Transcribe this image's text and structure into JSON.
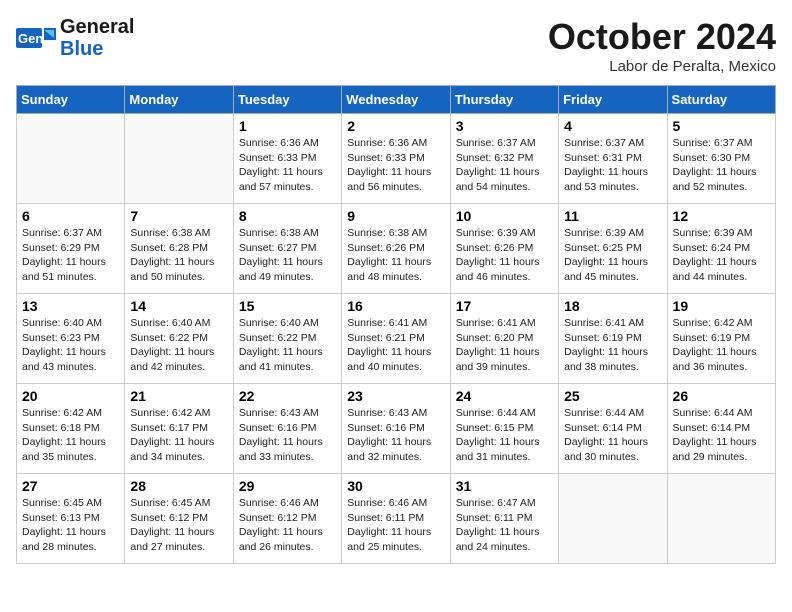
{
  "header": {
    "logo_line1": "General",
    "logo_line2": "Blue",
    "month": "October 2024",
    "location": "Labor de Peralta, Mexico"
  },
  "days_of_week": [
    "Sunday",
    "Monday",
    "Tuesday",
    "Wednesday",
    "Thursday",
    "Friday",
    "Saturday"
  ],
  "weeks": [
    [
      {
        "day": "",
        "sunrise": "",
        "sunset": "",
        "daylight": ""
      },
      {
        "day": "",
        "sunrise": "",
        "sunset": "",
        "daylight": ""
      },
      {
        "day": "1",
        "sunrise": "Sunrise: 6:36 AM",
        "sunset": "Sunset: 6:33 PM",
        "daylight": "Daylight: 11 hours and 57 minutes."
      },
      {
        "day": "2",
        "sunrise": "Sunrise: 6:36 AM",
        "sunset": "Sunset: 6:33 PM",
        "daylight": "Daylight: 11 hours and 56 minutes."
      },
      {
        "day": "3",
        "sunrise": "Sunrise: 6:37 AM",
        "sunset": "Sunset: 6:32 PM",
        "daylight": "Daylight: 11 hours and 54 minutes."
      },
      {
        "day": "4",
        "sunrise": "Sunrise: 6:37 AM",
        "sunset": "Sunset: 6:31 PM",
        "daylight": "Daylight: 11 hours and 53 minutes."
      },
      {
        "day": "5",
        "sunrise": "Sunrise: 6:37 AM",
        "sunset": "Sunset: 6:30 PM",
        "daylight": "Daylight: 11 hours and 52 minutes."
      }
    ],
    [
      {
        "day": "6",
        "sunrise": "Sunrise: 6:37 AM",
        "sunset": "Sunset: 6:29 PM",
        "daylight": "Daylight: 11 hours and 51 minutes."
      },
      {
        "day": "7",
        "sunrise": "Sunrise: 6:38 AM",
        "sunset": "Sunset: 6:28 PM",
        "daylight": "Daylight: 11 hours and 50 minutes."
      },
      {
        "day": "8",
        "sunrise": "Sunrise: 6:38 AM",
        "sunset": "Sunset: 6:27 PM",
        "daylight": "Daylight: 11 hours and 49 minutes."
      },
      {
        "day": "9",
        "sunrise": "Sunrise: 6:38 AM",
        "sunset": "Sunset: 6:26 PM",
        "daylight": "Daylight: 11 hours and 48 minutes."
      },
      {
        "day": "10",
        "sunrise": "Sunrise: 6:39 AM",
        "sunset": "Sunset: 6:26 PM",
        "daylight": "Daylight: 11 hours and 46 minutes."
      },
      {
        "day": "11",
        "sunrise": "Sunrise: 6:39 AM",
        "sunset": "Sunset: 6:25 PM",
        "daylight": "Daylight: 11 hours and 45 minutes."
      },
      {
        "day": "12",
        "sunrise": "Sunrise: 6:39 AM",
        "sunset": "Sunset: 6:24 PM",
        "daylight": "Daylight: 11 hours and 44 minutes."
      }
    ],
    [
      {
        "day": "13",
        "sunrise": "Sunrise: 6:40 AM",
        "sunset": "Sunset: 6:23 PM",
        "daylight": "Daylight: 11 hours and 43 minutes."
      },
      {
        "day": "14",
        "sunrise": "Sunrise: 6:40 AM",
        "sunset": "Sunset: 6:22 PM",
        "daylight": "Daylight: 11 hours and 42 minutes."
      },
      {
        "day": "15",
        "sunrise": "Sunrise: 6:40 AM",
        "sunset": "Sunset: 6:22 PM",
        "daylight": "Daylight: 11 hours and 41 minutes."
      },
      {
        "day": "16",
        "sunrise": "Sunrise: 6:41 AM",
        "sunset": "Sunset: 6:21 PM",
        "daylight": "Daylight: 11 hours and 40 minutes."
      },
      {
        "day": "17",
        "sunrise": "Sunrise: 6:41 AM",
        "sunset": "Sunset: 6:20 PM",
        "daylight": "Daylight: 11 hours and 39 minutes."
      },
      {
        "day": "18",
        "sunrise": "Sunrise: 6:41 AM",
        "sunset": "Sunset: 6:19 PM",
        "daylight": "Daylight: 11 hours and 38 minutes."
      },
      {
        "day": "19",
        "sunrise": "Sunrise: 6:42 AM",
        "sunset": "Sunset: 6:19 PM",
        "daylight": "Daylight: 11 hours and 36 minutes."
      }
    ],
    [
      {
        "day": "20",
        "sunrise": "Sunrise: 6:42 AM",
        "sunset": "Sunset: 6:18 PM",
        "daylight": "Daylight: 11 hours and 35 minutes."
      },
      {
        "day": "21",
        "sunrise": "Sunrise: 6:42 AM",
        "sunset": "Sunset: 6:17 PM",
        "daylight": "Daylight: 11 hours and 34 minutes."
      },
      {
        "day": "22",
        "sunrise": "Sunrise: 6:43 AM",
        "sunset": "Sunset: 6:16 PM",
        "daylight": "Daylight: 11 hours and 33 minutes."
      },
      {
        "day": "23",
        "sunrise": "Sunrise: 6:43 AM",
        "sunset": "Sunset: 6:16 PM",
        "daylight": "Daylight: 11 hours and 32 minutes."
      },
      {
        "day": "24",
        "sunrise": "Sunrise: 6:44 AM",
        "sunset": "Sunset: 6:15 PM",
        "daylight": "Daylight: 11 hours and 31 minutes."
      },
      {
        "day": "25",
        "sunrise": "Sunrise: 6:44 AM",
        "sunset": "Sunset: 6:14 PM",
        "daylight": "Daylight: 11 hours and 30 minutes."
      },
      {
        "day": "26",
        "sunrise": "Sunrise: 6:44 AM",
        "sunset": "Sunset: 6:14 PM",
        "daylight": "Daylight: 11 hours and 29 minutes."
      }
    ],
    [
      {
        "day": "27",
        "sunrise": "Sunrise: 6:45 AM",
        "sunset": "Sunset: 6:13 PM",
        "daylight": "Daylight: 11 hours and 28 minutes."
      },
      {
        "day": "28",
        "sunrise": "Sunrise: 6:45 AM",
        "sunset": "Sunset: 6:12 PM",
        "daylight": "Daylight: 11 hours and 27 minutes."
      },
      {
        "day": "29",
        "sunrise": "Sunrise: 6:46 AM",
        "sunset": "Sunset: 6:12 PM",
        "daylight": "Daylight: 11 hours and 26 minutes."
      },
      {
        "day": "30",
        "sunrise": "Sunrise: 6:46 AM",
        "sunset": "Sunset: 6:11 PM",
        "daylight": "Daylight: 11 hours and 25 minutes."
      },
      {
        "day": "31",
        "sunrise": "Sunrise: 6:47 AM",
        "sunset": "Sunset: 6:11 PM",
        "daylight": "Daylight: 11 hours and 24 minutes."
      },
      {
        "day": "",
        "sunrise": "",
        "sunset": "",
        "daylight": ""
      },
      {
        "day": "",
        "sunrise": "",
        "sunset": "",
        "daylight": ""
      }
    ]
  ]
}
